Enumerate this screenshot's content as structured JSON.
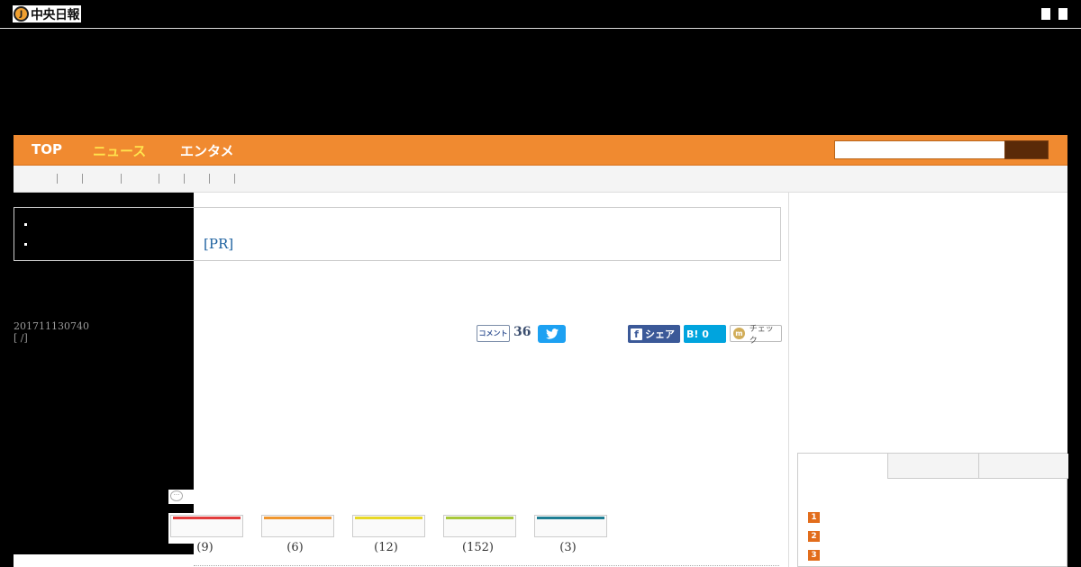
{
  "header": {
    "logo_mark": "J",
    "logo_text": "中央日報"
  },
  "nav": {
    "items": [
      "TOP",
      "ニュース",
      "エンタメ"
    ]
  },
  "pr_label": "[PR]",
  "article": {
    "date": "201711130740",
    "category": "[ /]"
  },
  "share": {
    "comment_label": "コメント",
    "comment_count": "36",
    "facebook_label": "シェア",
    "hatena_label": "B! 0",
    "mixi_label": "チェック",
    "mixi_mark": "m",
    "fb_mark": "f"
  },
  "reactions": {
    "bubble": "···",
    "buttons": [
      {
        "count": "(9)",
        "color": "#e23c3c"
      },
      {
        "count": "(6)",
        "color": "#f0962e"
      },
      {
        "count": "(12)",
        "color": "#e8d826"
      },
      {
        "count": "(152)",
        "color": "#a8c83a"
      },
      {
        "count": "(3)",
        "color": "#1e7e94"
      }
    ]
  },
  "ranking": {
    "numbers": [
      "1",
      "2",
      "3"
    ]
  }
}
